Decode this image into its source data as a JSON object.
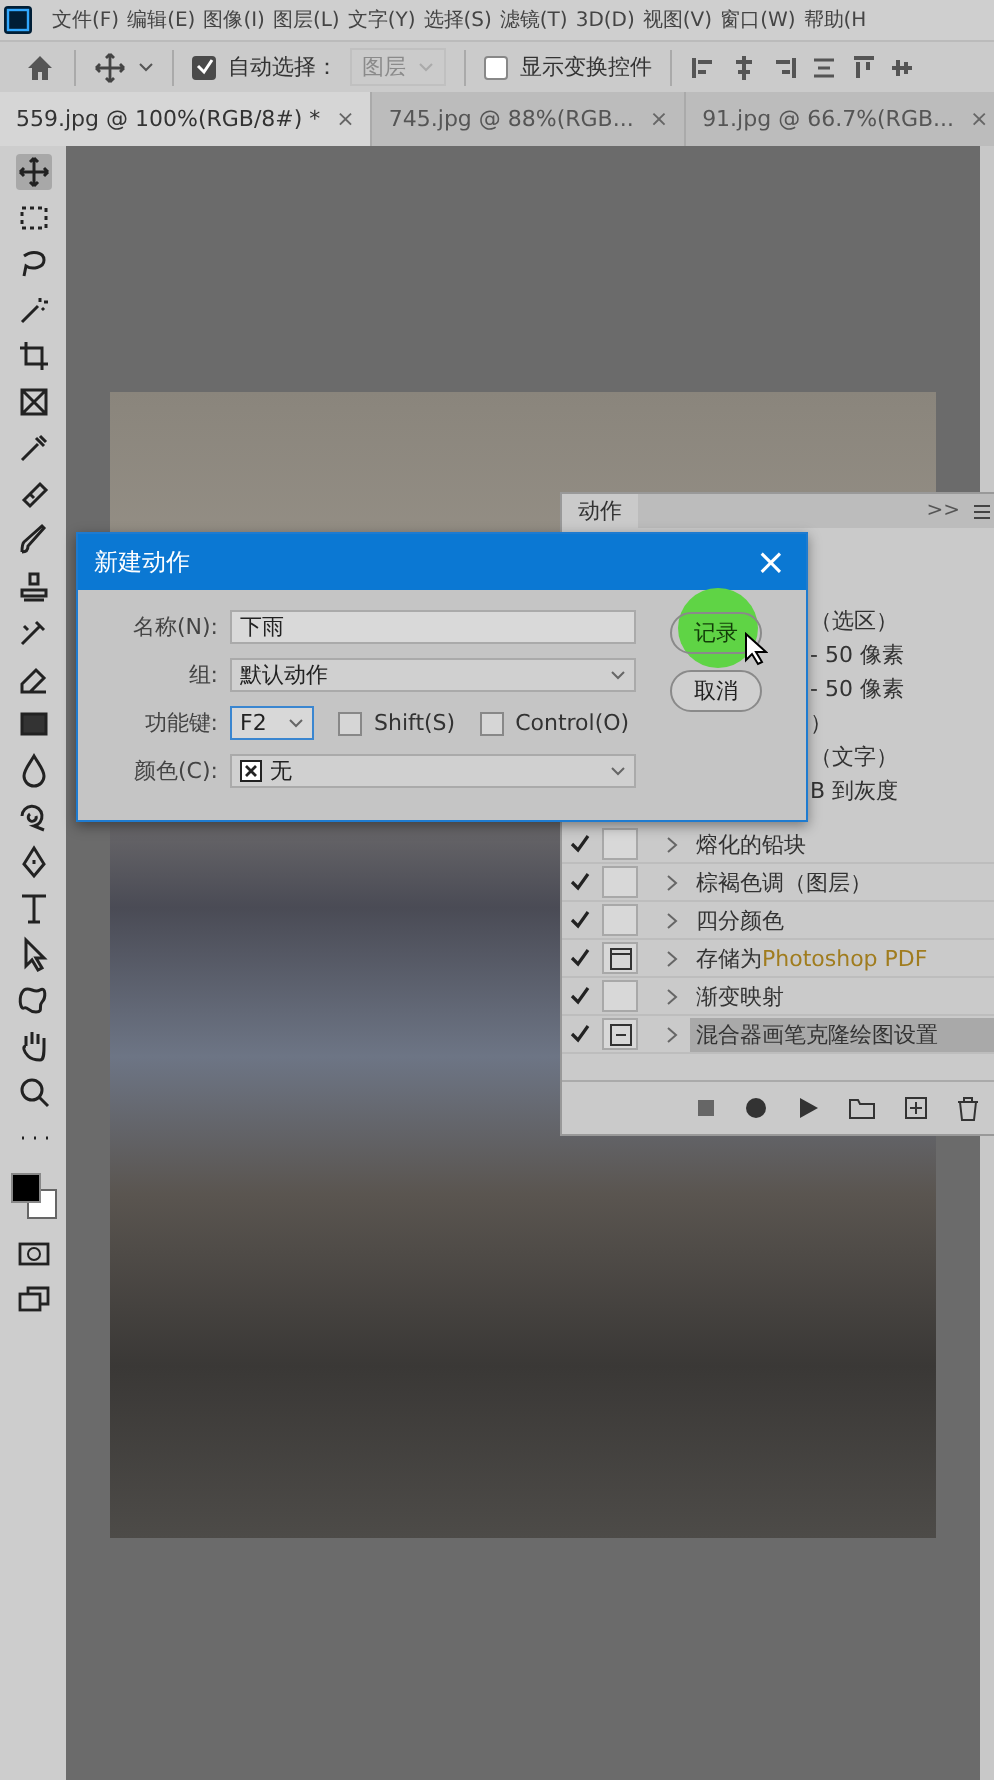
{
  "menu": [
    "文件(F)",
    "编辑(E)",
    "图像(I)",
    "图层(L)",
    "文字(Y)",
    "选择(S)",
    "滤镜(T)",
    "3D(D)",
    "视图(V)",
    "窗口(W)",
    "帮助(H"
  ],
  "options_bar": {
    "auto_select": {
      "label": "自动选择：",
      "checked": true
    },
    "layer_dropdown": {
      "value": "图层",
      "disabled": true
    },
    "show_transform": {
      "label": "显示变换控件",
      "checked": false
    }
  },
  "tabs": [
    {
      "label": "559.jpg @ 100%(RGB/8#) *",
      "close": "×",
      "selected": true
    },
    {
      "label": "745.jpg @ 88%(RGB...",
      "close": "×",
      "selected": false
    },
    {
      "label": "91.jpg @ 66.7%(RGB...",
      "close": "×",
      "selected": false
    }
  ],
  "actions_panel": {
    "tab": "动作",
    "collapse": ">>",
    "covered_rows": [
      "（选区）",
      "- 50 像素",
      "- 50 像素",
      "）",
      "（文字）",
      "B 到灰度"
    ],
    "rows": [
      {
        "label": "熔化的铅块",
        "checked": true,
        "kind": "plain",
        "selected": false
      },
      {
        "label": "棕褐色调（图层）",
        "checked": true,
        "kind": "plain",
        "selected": false
      },
      {
        "label": "四分颜色",
        "checked": true,
        "kind": "plain",
        "selected": false
      },
      {
        "label": "存储为",
        "highlight": "Photoshop PDF",
        "checked": true,
        "kind": "dialog",
        "selected": false
      },
      {
        "label": "渐变映射",
        "checked": true,
        "kind": "plain",
        "selected": false
      },
      {
        "label": "混合器画笔克隆绘图设置",
        "checked": true,
        "kind": "partial",
        "selected": true
      }
    ]
  },
  "dialog": {
    "title": "新建动作",
    "close": "×",
    "fields": [
      {
        "kind": "text",
        "label": "名称(N):",
        "value": "下雨"
      },
      {
        "kind": "select",
        "label": "组:",
        "value": "默认动作"
      },
      {
        "kind": "hotkey",
        "label": "功能键:",
        "value": "F2",
        "modifiers": [
          {
            "label": "Shift(S)",
            "checked": false
          },
          {
            "label": "Control(O)",
            "checked": false
          }
        ]
      },
      {
        "kind": "color",
        "label": "颜色(C):",
        "value": "无"
      }
    ],
    "buttons": [
      {
        "label": "记录",
        "highlighted": true
      },
      {
        "label": "取消",
        "highlighted": false
      }
    ]
  }
}
